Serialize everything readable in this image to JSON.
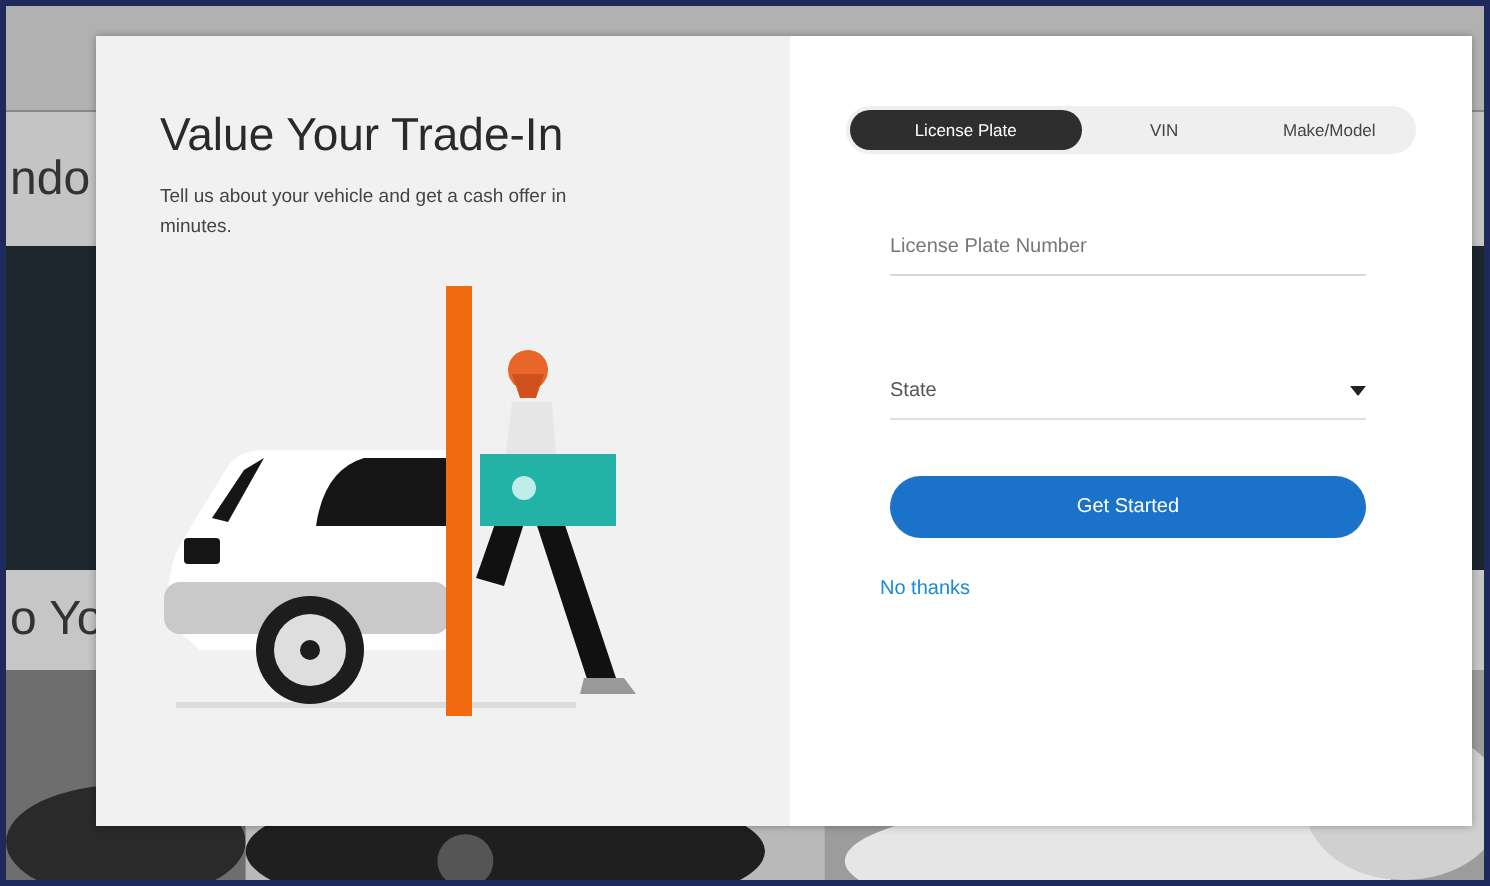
{
  "background_page": {
    "heading_fragment": "ndo",
    "subheading_fragment": "o Yo"
  },
  "modal": {
    "title": "Value Your Trade-In",
    "subtitle": "Tell us about your vehicle and get a cash offer in minutes.",
    "tabs": [
      {
        "label": "License Plate",
        "selected": true
      },
      {
        "label": "VIN",
        "selected": false
      },
      {
        "label": "Make/Model",
        "selected": false
      }
    ],
    "plate_field": {
      "placeholder": "License Plate Number"
    },
    "state_select": {
      "placeholder": "State"
    },
    "primary_button": "Get Started",
    "dismiss_link": "No thanks"
  }
}
